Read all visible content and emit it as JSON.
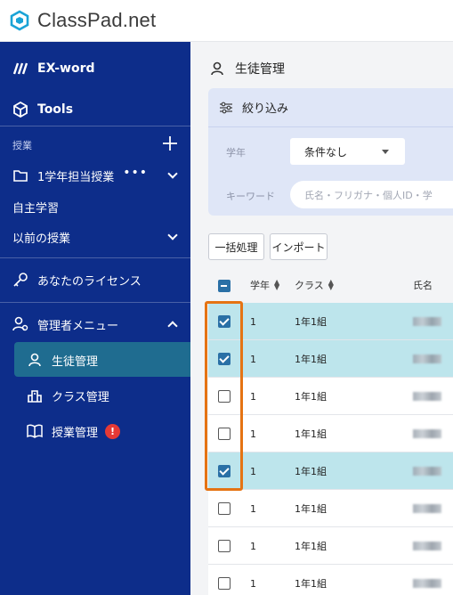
{
  "app": {
    "logo_text": "ClassPad.net"
  },
  "sidebar": {
    "exword": "EX-word",
    "tools": "Tools",
    "classes_section": "授業",
    "class_group": "1学年担当授業",
    "self_study": "自主学習",
    "past_classes": "以前の授業",
    "license": "あなたのライセンス",
    "admin_menu": "管理者メニュー",
    "admin_items": [
      {
        "label": "生徒管理"
      },
      {
        "label": "クラス管理"
      },
      {
        "label": "授業管理",
        "badge": "!"
      }
    ]
  },
  "main": {
    "title": "生徒管理",
    "filter": {
      "header": "絞り込み",
      "grade_label": "学年",
      "grade_value": "条件なし",
      "keyword_label": "キーワード",
      "keyword_placeholder": "氏名・フリガナ・個人ID・学"
    },
    "buttons": {
      "bulk": "一括処理",
      "import": "インポート"
    },
    "table": {
      "headers": {
        "grade": "学年",
        "class": "クラス",
        "name": "氏名"
      },
      "rows": [
        {
          "grade": "1",
          "class": "1年1組",
          "checked": true
        },
        {
          "grade": "1",
          "class": "1年1組",
          "checked": true
        },
        {
          "grade": "1",
          "class": "1年1組",
          "checked": false
        },
        {
          "grade": "1",
          "class": "1年1組",
          "checked": false
        },
        {
          "grade": "1",
          "class": "1年1組",
          "checked": true
        },
        {
          "grade": "1",
          "class": "1年1組",
          "checked": false
        },
        {
          "grade": "1",
          "class": "1年1組",
          "checked": false
        },
        {
          "grade": "1",
          "class": "1年1組",
          "checked": false
        }
      ]
    }
  },
  "colors": {
    "sidebar": "#0d2d8a",
    "active": "#1f6c90",
    "selected_row": "#bde5ec",
    "highlight": "#e57313",
    "alert": "#e53935"
  }
}
